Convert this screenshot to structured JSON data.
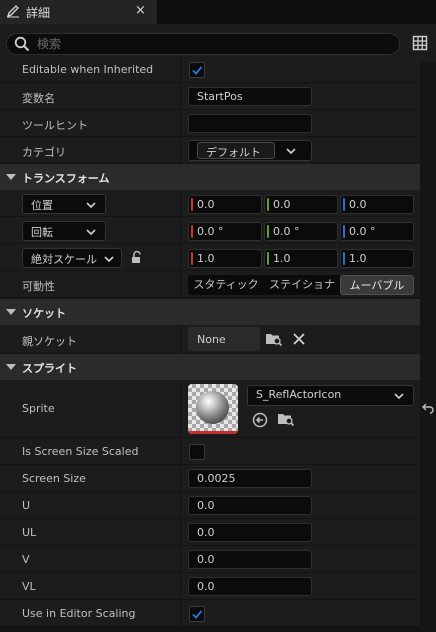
{
  "tab": {
    "title": "詳細",
    "close_glyph": "×"
  },
  "search": {
    "placeholder": "検索"
  },
  "top_rows": {
    "editable_label": "Editable when Inherited",
    "editable_checked": true,
    "varname_label": "変数名",
    "varname_value": "StartPos",
    "tooltip_label": "ツールヒント",
    "tooltip_value": "",
    "category_label": "カテゴリ",
    "category_value": "デフォルト"
  },
  "transform": {
    "section_title": "トランスフォーム",
    "location": {
      "mode": "位置",
      "x": "0.0",
      "y": "0.0",
      "z": "0.0"
    },
    "rotation": {
      "mode": "回転",
      "x": "0.0 °",
      "y": "0.0 °",
      "z": "0.0 °"
    },
    "scale": {
      "mode": "絶対スケール",
      "x": "1.0",
      "y": "1.0",
      "z": "1.0"
    },
    "mobility_label": "可動性",
    "mobility_options": [
      "スタティック",
      "ステイショナ",
      "ムーバブル"
    ],
    "mobility_selected": "ムーバブル"
  },
  "socket": {
    "section_title": "ソケット",
    "parent_label": "親ソケット",
    "parent_value": "None"
  },
  "sprite_section": {
    "section_title": "スプライト",
    "sprite_label": "Sprite",
    "sprite_asset": "S_ReflActorIcon",
    "screen_size_scaled_label": "Is Screen Size Scaled",
    "screen_size_scaled_checked": false,
    "screen_size_label": "Screen Size",
    "screen_size_value": "0.0025",
    "u_label": "U",
    "u_value": "0.0",
    "ul_label": "UL",
    "ul_value": "0.0",
    "v_label": "V",
    "v_value": "0.0",
    "vl_label": "VL",
    "vl_value": "0.0",
    "editor_scaling_label": "Use in Editor Scaling",
    "editor_scaling_checked": true
  },
  "colors": {
    "axis_x": "#c8362d",
    "axis_y": "#6c9a2a",
    "axis_z": "#2f6fd2",
    "check_blue": "#2f6fd2",
    "panel_bg": "#1c1c1c",
    "section_bg": "#2b2b2b"
  },
  "icons": [
    "pencil-icon",
    "search-icon",
    "grid-icon",
    "chevron-down-icon",
    "lock-icon",
    "browse-icon",
    "clear-icon",
    "use-selected-icon",
    "reset-arrow-icon"
  ]
}
